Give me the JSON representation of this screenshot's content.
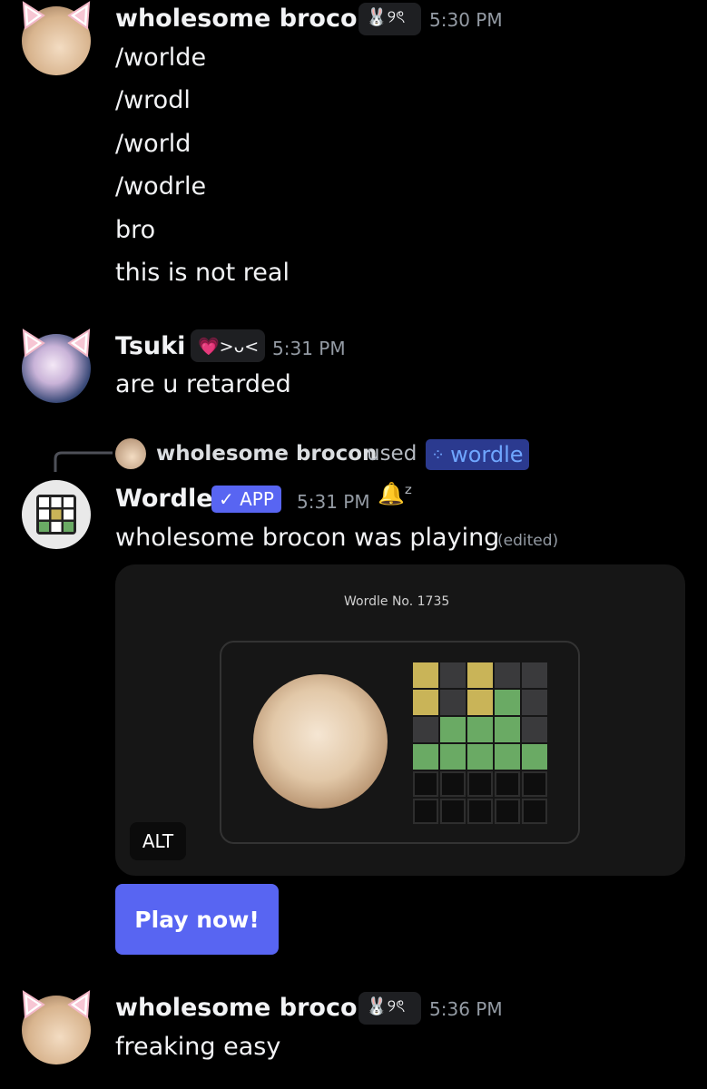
{
  "messages": [
    {
      "author": "wholesome brocon",
      "tag": "🐰୨ৎ",
      "time": "5:30 PM",
      "lines": [
        "/worlde",
        "/wrodl",
        "/world",
        "/wodrle",
        "bro",
        "this is not real"
      ]
    },
    {
      "author": "Tsuki",
      "tag": "💗>ᴗ<",
      "time": "5:31 PM",
      "lines": [
        "are u retarded"
      ]
    },
    {
      "reply": {
        "user": "wholesome brocon",
        "used": "used",
        "command": "wordle"
      },
      "author": "Wordle",
      "app_badge": "✓ APP",
      "time": "5:31 PM",
      "snooze": "🔔ᶻ",
      "lines": [
        "wholesome brocon was playing"
      ],
      "edited": "(edited)",
      "embed": {
        "title": "Wordle No. 1735",
        "alt": "ALT",
        "grid": [
          [
            "y",
            "g",
            "y",
            "g",
            "g"
          ],
          [
            "y",
            "g",
            "y",
            "G",
            "g"
          ],
          [
            "g",
            "G",
            "G",
            "G",
            "g"
          ],
          [
            "G",
            "G",
            "G",
            "G",
            "G"
          ],
          [
            "e",
            "e",
            "e",
            "e",
            "e"
          ],
          [
            "e",
            "e",
            "e",
            "e",
            "e"
          ]
        ]
      },
      "button": "Play now!"
    },
    {
      "author": "wholesome brocon",
      "tag": "🐰୨ৎ",
      "time": "5:36 PM",
      "lines": [
        "freaking easy"
      ]
    }
  ],
  "colors": {
    "yellow": "#c9b458",
    "green": "#6aaa64",
    "gray": "#3a3a3c",
    "blurple": "#5865f2"
  }
}
